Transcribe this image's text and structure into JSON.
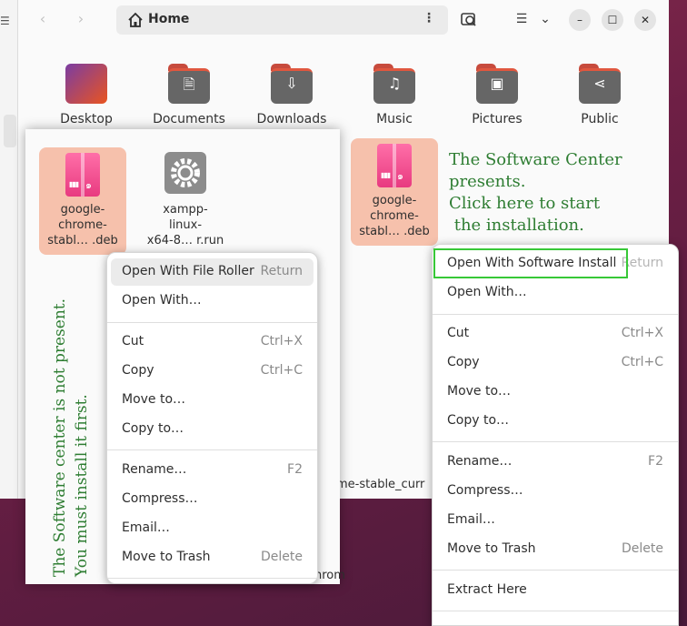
{
  "window": {
    "path_label": "Home"
  },
  "folders": [
    {
      "label": "Desktop",
      "icon": "desktop-folder-icon"
    },
    {
      "label": "Documents",
      "icon": "document-icon",
      "glyph": "🗎"
    },
    {
      "label": "Downloads",
      "icon": "download-icon",
      "glyph": "⇩"
    },
    {
      "label": "Music",
      "icon": "music-icon",
      "glyph": "♫"
    },
    {
      "label": "Pictures",
      "icon": "picture-icon",
      "glyph": "▣"
    },
    {
      "label": "Public",
      "icon": "share-icon",
      "glyph": "⋖"
    }
  ],
  "left_files": [
    {
      "line1": "google-",
      "line2": "chrome-",
      "line3": "stabl… .deb"
    },
    {
      "line1": "xampp-",
      "line2": "linux-",
      "line3": "x64-8… r.run"
    }
  ],
  "right_file": {
    "line1": "google-",
    "line2": "chrome-",
    "line3": "stabl… .deb"
  },
  "left_menu": {
    "items": [
      {
        "label": "Open With File Roller",
        "key": "Return"
      },
      {
        "label": "Open With…",
        "key": ""
      },
      {
        "label": "Cut",
        "key": "Ctrl+X"
      },
      {
        "label": "Copy",
        "key": "Ctrl+C"
      },
      {
        "label": "Move to…",
        "key": ""
      },
      {
        "label": "Copy to…",
        "key": ""
      },
      {
        "label": "Rename…",
        "key": "F2"
      },
      {
        "label": "Compress…",
        "key": ""
      },
      {
        "label": "Email…",
        "key": ""
      },
      {
        "label": "Move to Trash",
        "key": "Delete"
      }
    ]
  },
  "right_menu": {
    "items": [
      {
        "label": "Open With Software Install",
        "key": "Return"
      },
      {
        "label": "Open With…",
        "key": ""
      },
      {
        "label": "Cut",
        "key": "Ctrl+X"
      },
      {
        "label": "Copy",
        "key": "Ctrl+C"
      },
      {
        "label": "Move to…",
        "key": ""
      },
      {
        "label": "Copy to…",
        "key": ""
      },
      {
        "label": "Rename…",
        "key": "F2"
      },
      {
        "label": "Compress…",
        "key": ""
      },
      {
        "label": "Email…",
        "key": ""
      },
      {
        "label": "Move to Trash",
        "key": "Delete"
      },
      {
        "label": "Extract Here",
        "key": ""
      }
    ]
  },
  "annotations": {
    "vertical_line1": "The Software center is not present.",
    "vertical_line2": "You must install it first.",
    "callout_line1": "The Software Center",
    "callout_line2": "presents.",
    "callout_line3": "Click here to start",
    "callout_line4": " the installation."
  },
  "fragments": {
    "status_text": "me-stable_curr",
    "status_text2": "hrom"
  },
  "colors": {
    "annotation": "#2e7d32",
    "highlight_box": "#37c837",
    "selection": "#f6c1ac",
    "accent": "#e95420"
  }
}
